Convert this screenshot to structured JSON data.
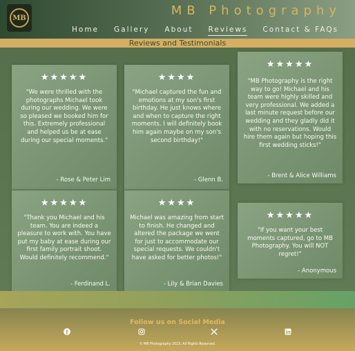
{
  "brand": {
    "logo_text": "MB",
    "title": "MB Photography"
  },
  "nav": {
    "items": [
      {
        "label": "Home"
      },
      {
        "label": "Gallery"
      },
      {
        "label": "About"
      },
      {
        "label": "Reviews",
        "active": true
      },
      {
        "label": "Contact & FAQs"
      }
    ]
  },
  "section_title": "Reviews and Testimonials",
  "reviews": [
    {
      "rating": 5,
      "stars": "★★★★★",
      "quote": "\"We were thrilled with the photographs Michael took during our wedding. We were so pleased we booked him for this. Extremely professional and helped us be at ease during our special moments.\"",
      "author": "- Rose & Peter Lim"
    },
    {
      "rating": 4,
      "stars": "★★★★",
      "quote": "\"Michael captured the fun and emotions at my son's first birthday. He just knows where and when to capture the right moments. I will definitely book him again maybe on my son's second birthday!\"",
      "author": "- Glenn B."
    },
    {
      "rating": 5,
      "stars": "★★★★★",
      "quote": "\"MB Photography is the right way to go! Michael and his team were highly skilled and very professional. We added a last minute request before our wedding and they gladly did it with no reservations. Would hire them again but hoping this first wedding sticks!\"",
      "author": "- Brent & Alice Williams"
    },
    {
      "rating": 5,
      "stars": "★★★★★",
      "quote": "\"Thank you Michael and his team. You are indeed a pleasure to work with. You have put my baby at ease during our first family portrait shoot. Would definitely recommend.\"",
      "author": "- Ferdinand L."
    },
    {
      "rating": 4,
      "stars": "★★★★",
      "quote": "Michael was amazing from start to finish. He changed and altered the package we went for just to accommodate our special requests. We couldn't have asked for better photos!\"",
      "author": "- Lily & Brian Davies"
    },
    {
      "rating": 5,
      "stars": "★★★★★",
      "quote": "\"If you want your best moments captured, go to MB Photography. You will NOT regret!\"",
      "author": "- Anonymous"
    }
  ],
  "footer": {
    "follow_label": "Follow us on Social Media",
    "social_icons": [
      "facebook-icon",
      "instagram-icon",
      "x-icon",
      "linkedin-icon"
    ],
    "copyright": "© MB Photography 2023. All Rights Reserved."
  },
  "colors": {
    "gold": "#d9b45a",
    "section_bar": "#d4ae62",
    "main_green": "#5e7152"
  }
}
